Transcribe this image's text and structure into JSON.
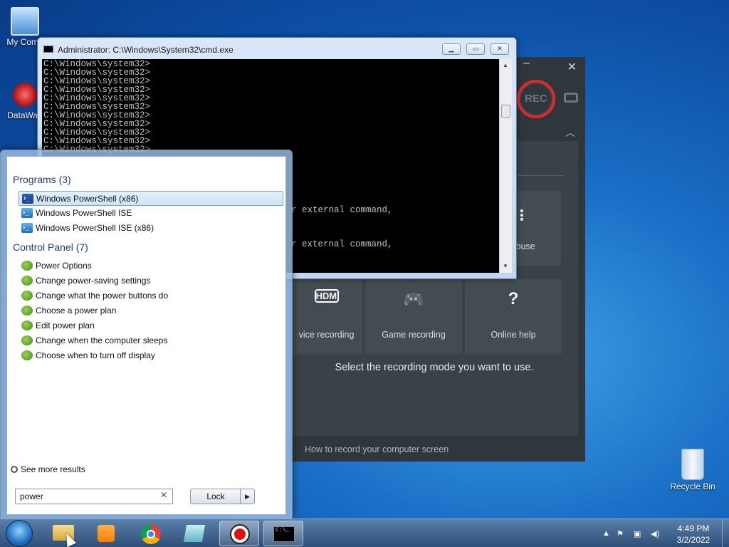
{
  "desktop": {
    "icons": [
      {
        "label": "My Comp"
      },
      {
        "label": "DataWag"
      },
      {
        "label": "Recycle Bin"
      }
    ]
  },
  "cmd": {
    "title": "Administrator: C:\\Windows\\System32\\cmd.exe",
    "prompt_lines": [
      "C:\\Windows\\system32>",
      "C:\\Windows\\system32>",
      "C:\\Windows\\system32>",
      "C:\\Windows\\system32>",
      "C:\\Windows\\system32>",
      "C:\\Windows\\system32>",
      "C:\\Windows\\system32>",
      "C:\\Windows\\system32>",
      "C:\\Windows\\system32>",
      "C:\\Windows\\system32>",
      "C:\\Windows\\system32>"
    ],
    "partial_line_1": "r external command,",
    "partial_line_2": "r external command,"
  },
  "recorder": {
    "rec_label": "REC",
    "tile_partial_label": "mouse",
    "tiles": [
      {
        "icon": "HDMI",
        "label": "vice recording"
      },
      {
        "icon": "🎮",
        "label": "Game recording"
      },
      {
        "icon": "?",
        "label": "Online help"
      }
    ],
    "hint": "Select the recording mode you want to use.",
    "howto": "How to record your computer screen"
  },
  "start_menu": {
    "programs_header": "Programs (3)",
    "programs": [
      {
        "label": "Windows PowerShell (x86)"
      },
      {
        "label": "Windows PowerShell ISE"
      },
      {
        "label": "Windows PowerShell ISE (x86)"
      }
    ],
    "cp_header": "Control Panel (7)",
    "control_panel": [
      {
        "label": "Power Options"
      },
      {
        "label": "Change power-saving settings"
      },
      {
        "label": "Change what the power buttons do"
      },
      {
        "label": "Choose a power plan"
      },
      {
        "label": "Edit power plan"
      },
      {
        "label": "Change when the computer sleeps"
      },
      {
        "label": "Choose when to turn off display"
      }
    ],
    "see_more": "See more results",
    "search_value": "power",
    "lock_label": "Lock"
  },
  "taskbar": {
    "time": "4:49 PM",
    "date": "3/2/2022"
  }
}
